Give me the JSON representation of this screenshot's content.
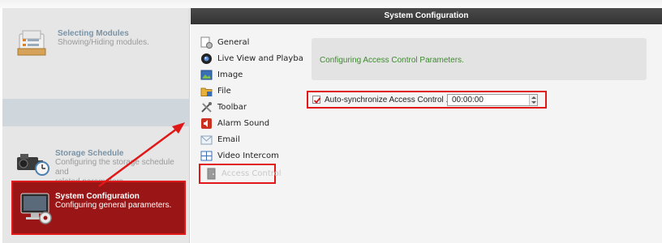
{
  "dialog": {
    "title": "System Configuration"
  },
  "modules": {
    "selecting": {
      "title": "Selecting Modules",
      "desc": "Showing/Hiding modules."
    },
    "storage": {
      "title": "Storage Schedule",
      "desc_line1": "Configuring the storage schedule and",
      "desc_line2": "related parameters."
    },
    "system": {
      "title": "System Configuration",
      "desc": "Configuring general parameters."
    }
  },
  "nav": {
    "items": [
      {
        "label": "General",
        "icon": "general-icon"
      },
      {
        "label": "Live View and Playback",
        "icon": "live-view-icon"
      },
      {
        "label": "Image",
        "icon": "image-icon"
      },
      {
        "label": "File",
        "icon": "file-icon"
      },
      {
        "label": "Toolbar",
        "icon": "toolbar-icon"
      },
      {
        "label": "Alarm Sound",
        "icon": "alarm-sound-icon"
      },
      {
        "label": "Email",
        "icon": "email-icon"
      },
      {
        "label": "Video Intercom",
        "icon": "video-intercom-icon"
      },
      {
        "label": "Access Control",
        "icon": "access-control-icon"
      }
    ]
  },
  "content": {
    "info": "Configuring Access Control Parameters.",
    "sync_label": "Auto-synchronize Access Control ...",
    "sync_checked": true,
    "sync_time": "00:00:00"
  },
  "colors": {
    "highlight": "#e01818",
    "selected_module_bg": "#9a1515",
    "info_text": "#3d8a2d",
    "titlebar": "#3a3a3a"
  }
}
